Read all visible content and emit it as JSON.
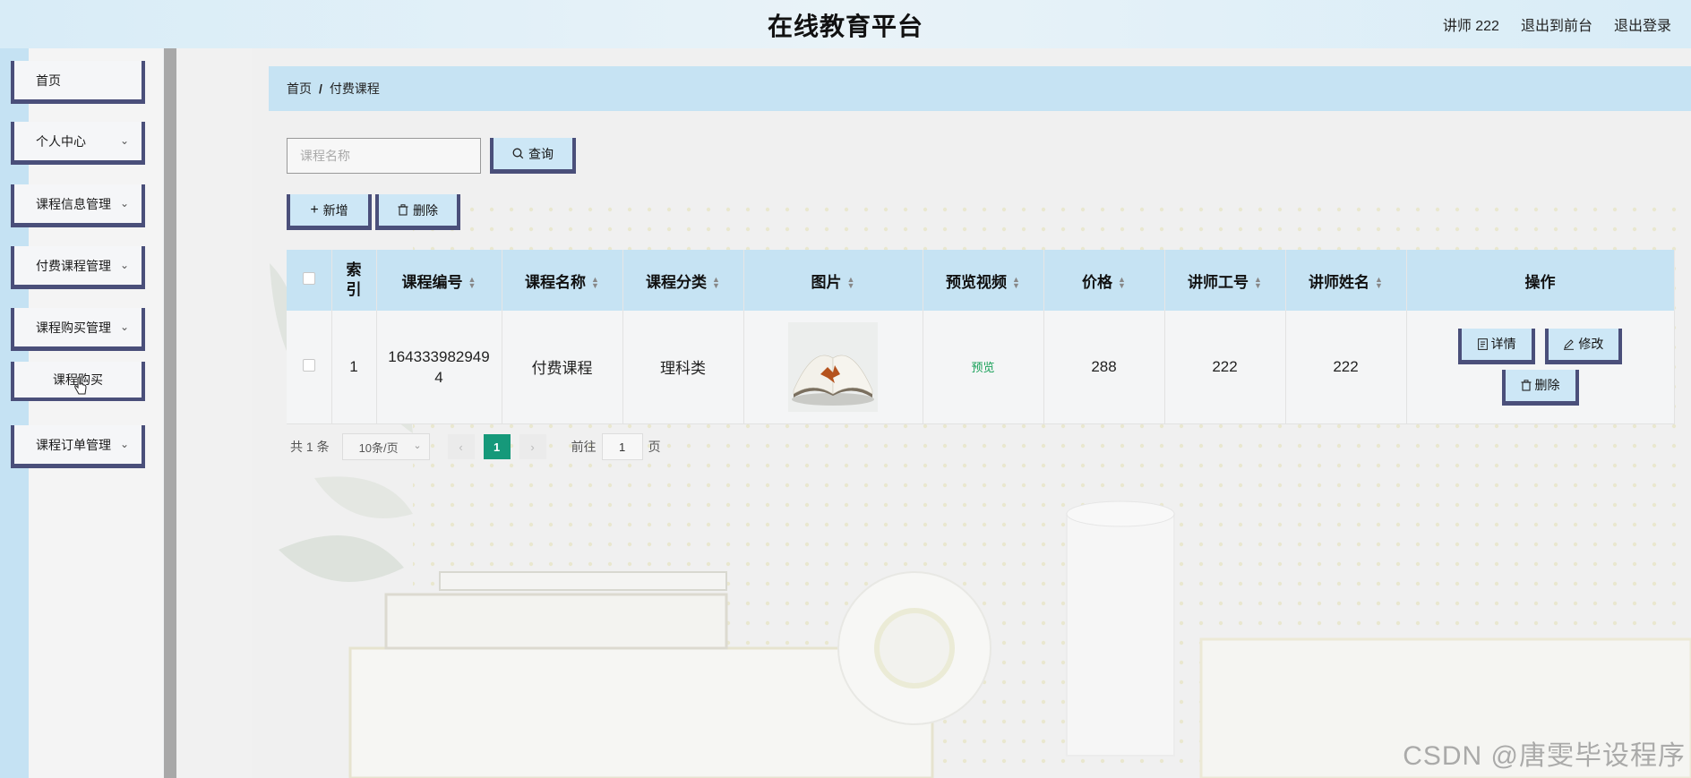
{
  "header": {
    "title": "在线教育平台",
    "user": "讲师 222",
    "to_front": "退出到前台",
    "logout": "退出登录"
  },
  "sidebar": {
    "items": [
      {
        "label": "首页"
      },
      {
        "label": "个人中心"
      },
      {
        "label": "课程信息管理"
      },
      {
        "label": "付费课程管理"
      },
      {
        "label": "课程购买管理"
      },
      {
        "label": "课程订单管理"
      }
    ],
    "submenu_item": "课程购买"
  },
  "breadcrumb": {
    "home": "首页",
    "separator": "/",
    "current": "付费课程"
  },
  "search": {
    "placeholder": "课程名称",
    "query_label": "查询"
  },
  "toolbar": {
    "add_label": "新增",
    "delete_label": "删除"
  },
  "table": {
    "headers": [
      "索引",
      "课程编号",
      "课程名称",
      "课程分类",
      "图片",
      "预览视频",
      "价格",
      "讲师工号",
      "讲师姓名",
      "操作"
    ],
    "rows": [
      {
        "index": "1",
        "course_no": "1643339829494",
        "course_name": "付费课程",
        "category": "理科类",
        "preview": "预览",
        "price": "288",
        "teacher_id": "222",
        "teacher_name": "222",
        "detail_label": "详情",
        "edit_label": "修改",
        "delete_label": "删除"
      }
    ]
  },
  "pagination": {
    "total": "共 1 条",
    "page_size": "10条/页",
    "current_page": "1",
    "goto_label": "前往",
    "goto_value": "1",
    "page_unit": "页"
  },
  "watermark": "CSDN @唐雯毕设程序",
  "colors": {
    "header_bg": "#d8ecf7",
    "accent_border": "#4a4f7a",
    "button_bg": "#cde7f6",
    "active_page": "#16997a",
    "preview_link": "#18a058"
  }
}
